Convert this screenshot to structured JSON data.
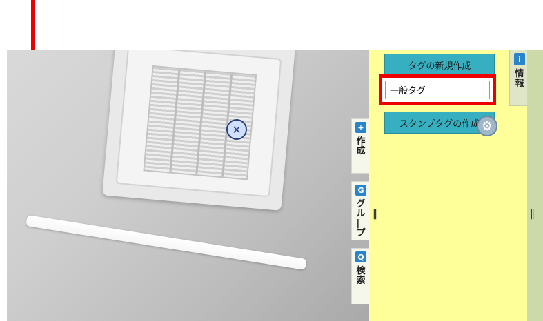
{
  "left_tabs": [
    {
      "label": "作\n成",
      "icon": "create-icon"
    },
    {
      "label": "グ\nル\n|\nプ",
      "icon": "group-icon"
    },
    {
      "label": "検\n索",
      "icon": "search-icon"
    }
  ],
  "right_tab": {
    "label": "情\n報",
    "icon": "info-icon"
  },
  "panel": {
    "new_tag_button": "タグの新規作成",
    "tag_value": "一般タグ",
    "stamp_tag_button": "スタンプタグの作成",
    "divider": "‖"
  },
  "right_divider": "‖",
  "colors": {
    "panel_bg": "#ffff99",
    "button_bg": "#36b0c0",
    "highlight": "#ee0000"
  }
}
